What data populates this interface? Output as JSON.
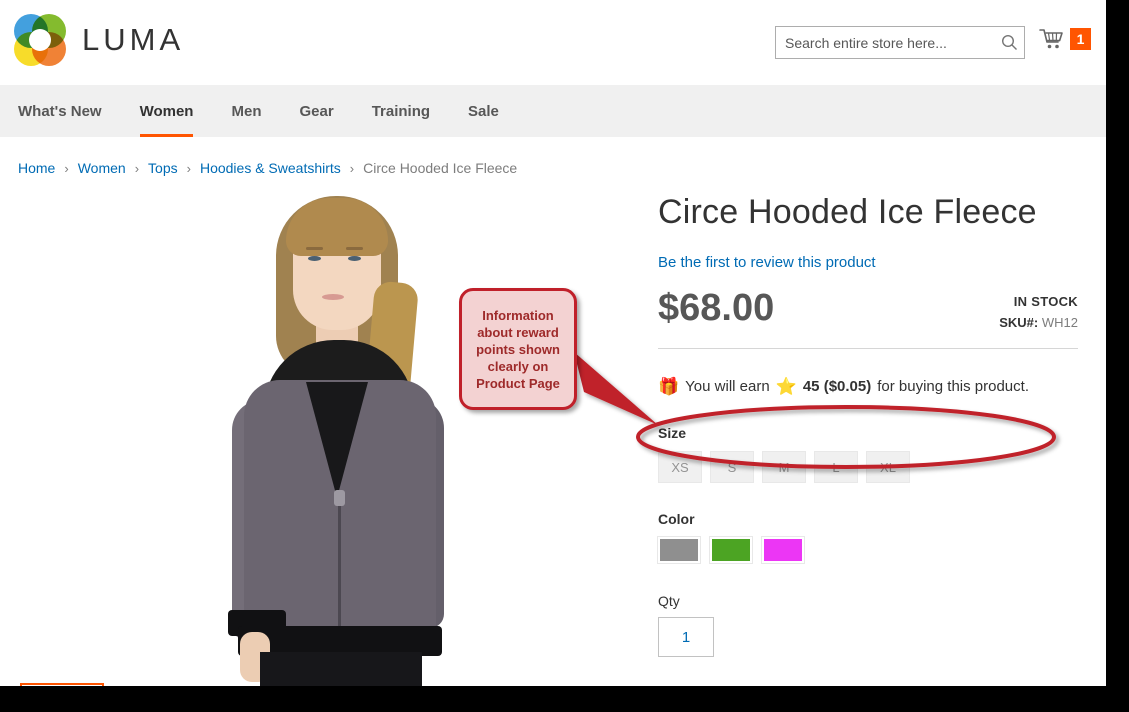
{
  "header": {
    "brand": "LUMA",
    "logo_icon": "luma-flower-logo",
    "search": {
      "placeholder": "Search entire store here...",
      "value": "",
      "icon": "search-icon"
    },
    "cart": {
      "icon": "shopping-cart-icon",
      "count": "1",
      "badge_color": "#ff5501"
    }
  },
  "nav": {
    "items": [
      {
        "label": "What's New",
        "active": false
      },
      {
        "label": "Women",
        "active": true
      },
      {
        "label": "Men",
        "active": false
      },
      {
        "label": "Gear",
        "active": false
      },
      {
        "label": "Training",
        "active": false
      },
      {
        "label": "Sale",
        "active": false
      }
    ],
    "active_underline_color": "#ff5501"
  },
  "breadcrumbs": {
    "separator": "›",
    "items": [
      {
        "label": "Home",
        "current": false
      },
      {
        "label": "Women",
        "current": false
      },
      {
        "label": "Tops",
        "current": false
      },
      {
        "label": "Hoodies & Sweatshirts",
        "current": false
      },
      {
        "label": "Circe Hooded Ice Fleece",
        "current": true
      }
    ]
  },
  "product": {
    "title": "Circe Hooded Ice Fleece",
    "review_link": "Be the first to review this product",
    "price": "$68.00",
    "stock_status": "IN STOCK",
    "sku_label": "SKU#:",
    "sku_value": "WH12",
    "gallery": {
      "main_image_alt": "Woman wearing gray hooded ice fleece jacket",
      "thumbnail_alt": "Circe Hooded Ice Fleece thumbnail"
    },
    "reward": {
      "gift_icon": "gift-emoji",
      "text_before": "You will earn",
      "star_icon": "star-emoji",
      "points": "45 ($0.05)",
      "text_after": "for buying this product."
    },
    "options": {
      "size_label": "Size",
      "sizes": [
        "XS",
        "S",
        "M",
        "L",
        "XL"
      ],
      "color_label": "Color",
      "colors": [
        {
          "name": "Gray",
          "hex": "#8f8f8f"
        },
        {
          "name": "Green",
          "hex": "#4ca423"
        },
        {
          "name": "Purple",
          "hex": "#ec36f5"
        }
      ],
      "qty_label": "Qty",
      "qty_value": "1"
    }
  },
  "annotation": {
    "callout_text": "Information about reward points shown clearly on Product Page",
    "highlight_color": "#c0202a",
    "callout_fill": "#f3d2d2",
    "callout_text_color": "#9e2a2a"
  }
}
